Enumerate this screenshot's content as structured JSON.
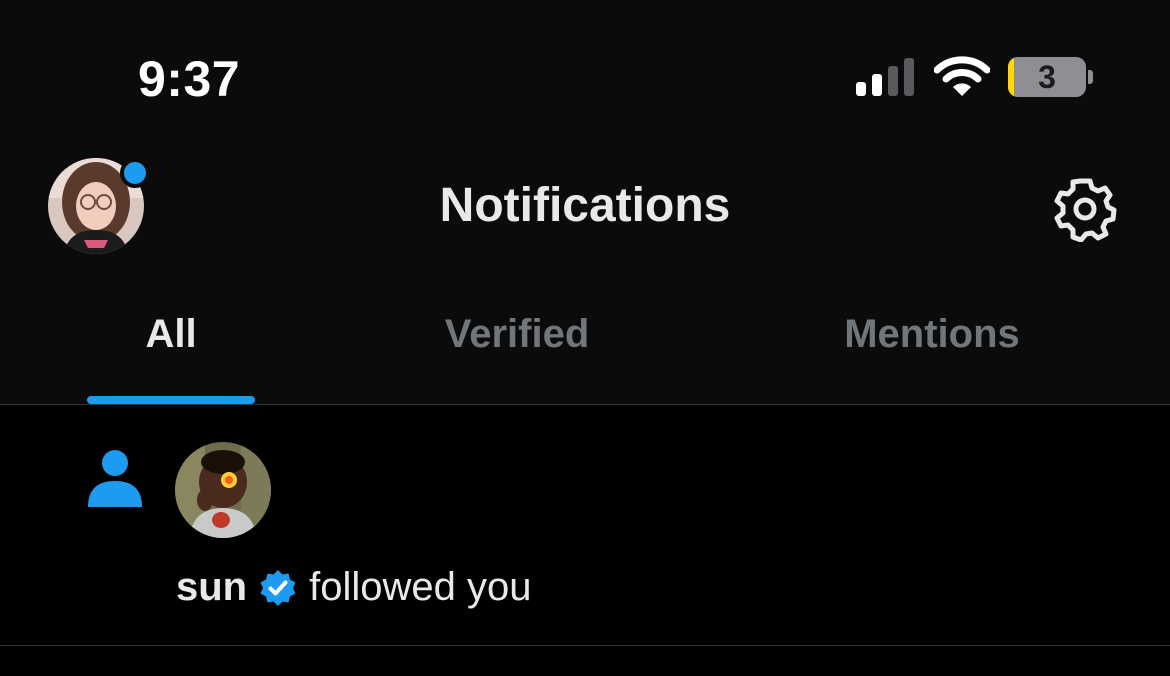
{
  "status_bar": {
    "time": "9:37",
    "battery_level": "3",
    "battery_fraction": 0.03,
    "signal_bars_active": 2,
    "signal_bars_total": 4
  },
  "header": {
    "title": "Notifications",
    "settings_icon": "gear-icon",
    "avatar_has_dot": true
  },
  "tabs": [
    {
      "label": "All",
      "active": true
    },
    {
      "label": "Verified",
      "active": false
    },
    {
      "label": "Mentions",
      "active": false
    }
  ],
  "notifications": [
    {
      "type_icon": "person-icon",
      "user": "sun",
      "verified": true,
      "action": "followed you"
    }
  ],
  "colors": {
    "accent": "#1d9bf0",
    "background": "#000000",
    "header_background": "#0b0b0c",
    "text_primary": "#e7e9ea",
    "text_secondary": "#71767b",
    "divider": "#2f3336",
    "battery_fill": "#ffd60a",
    "battery_body": "#8e8e93"
  }
}
